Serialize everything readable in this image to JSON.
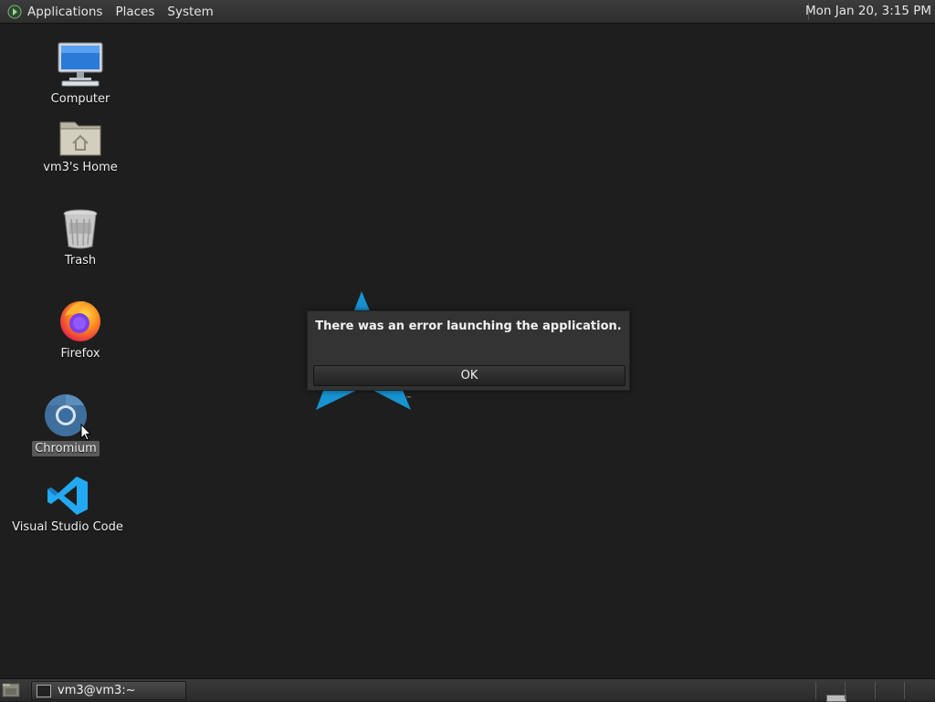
{
  "top_panel": {
    "menus": [
      "Applications",
      "Places",
      "System"
    ],
    "clock": "Mon Jan 20,  3:15 PM"
  },
  "desktop": {
    "icons": [
      {
        "label": "Computer",
        "icon": "computer-icon"
      },
      {
        "label": "vm3's Home",
        "icon": "home-folder-icon"
      },
      {
        "label": "Trash",
        "icon": "trash-icon"
      },
      {
        "label": "Firefox",
        "icon": "firefox-icon"
      },
      {
        "label": "Chromium",
        "icon": "chromium-icon",
        "selected": true
      },
      {
        "label": "Visual Studio Code",
        "icon": "vscode-icon"
      }
    ]
  },
  "dialog": {
    "message": "There was an error launching the application.",
    "ok_label": "OK"
  },
  "taskbar": {
    "window_label": "vm3@vm3:~"
  },
  "colors": {
    "desktop_bg": "#1e1e1e",
    "logo_blue": "#1793d1",
    "vscode_blue": "#23a9f2"
  }
}
